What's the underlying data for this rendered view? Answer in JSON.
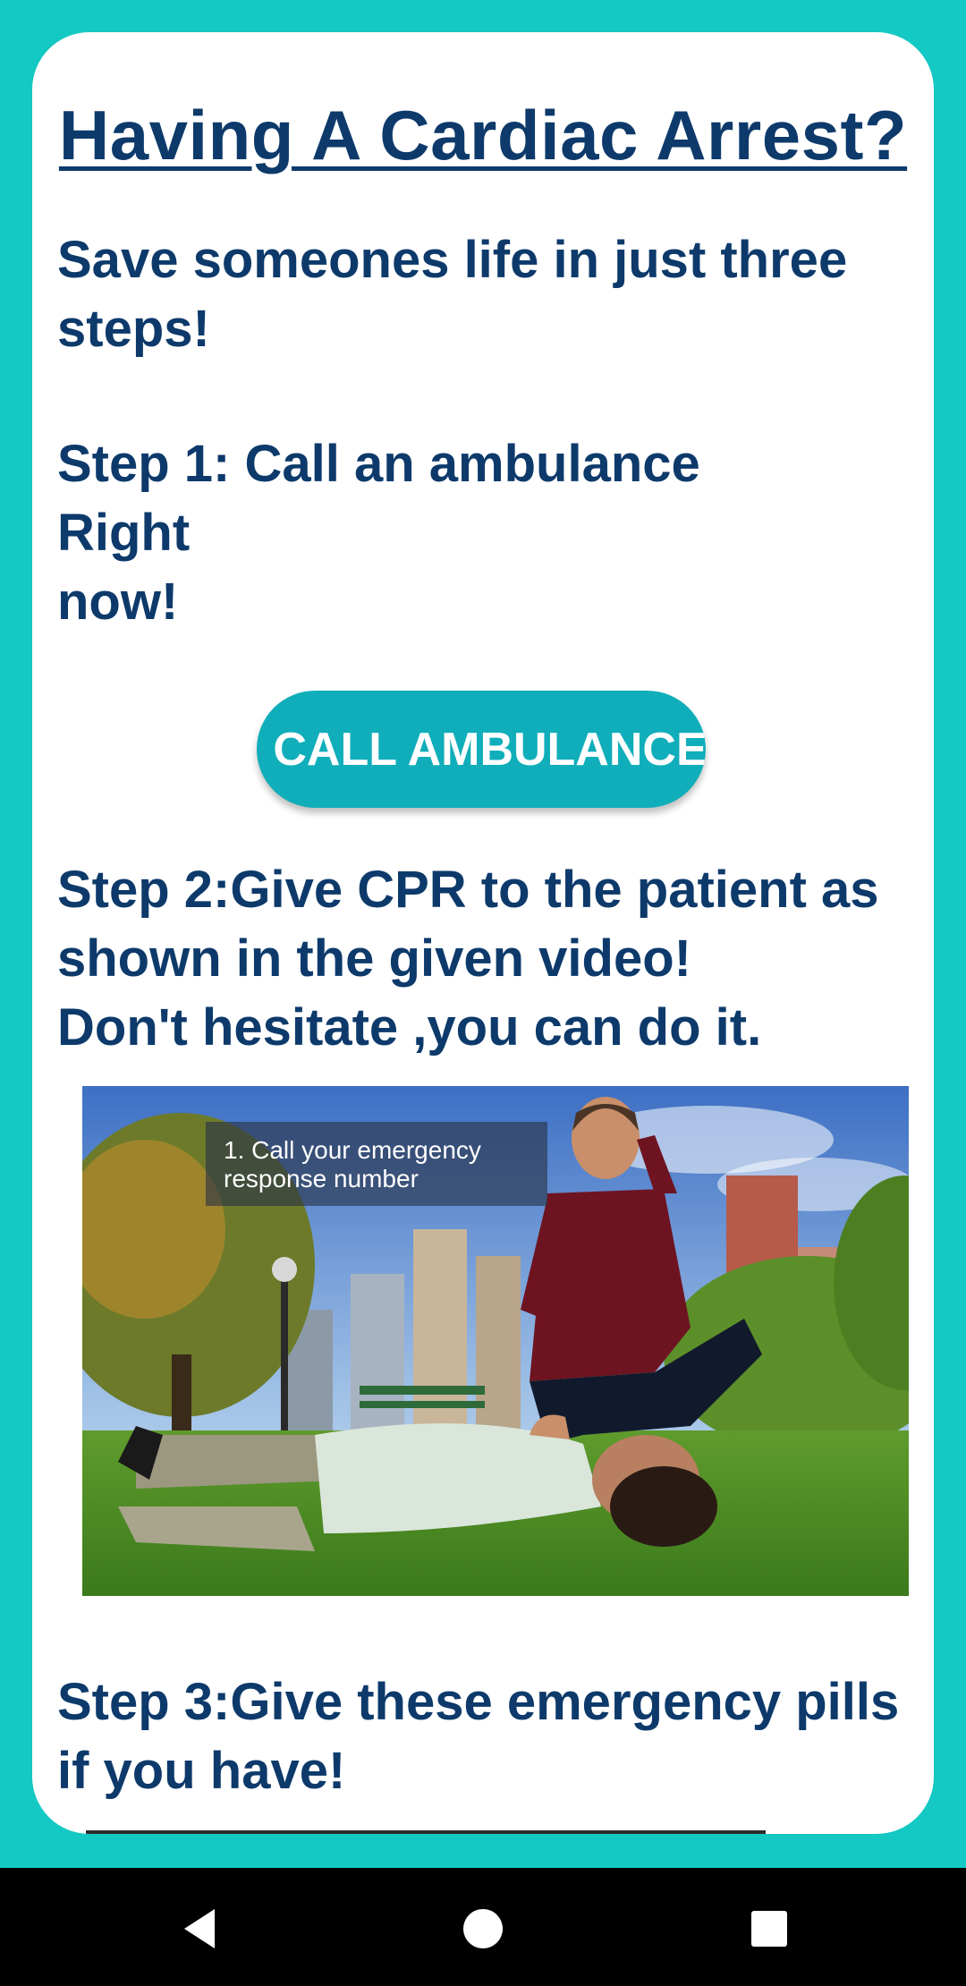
{
  "colors": {
    "background": "#14c8c3",
    "card": "#ffffff",
    "text": "#0d3a6b",
    "button": "#10aeba",
    "nav_bar": "#000000"
  },
  "page": {
    "title": "Having A Cardiac Arrest?",
    "intro": "Save someones life in just three steps!",
    "step1": " Step 1: Call an ambulance\nRight\n now!",
    "call_button_label": "CALL AMBULANCE",
    "step2": "Step 2:Give CPR to the patient as shown in the given video!\nDon't hesitate ,you can do it.",
    "video_caption": "1. Call your emergency\nresponse number",
    "step3": "Step 3:Give these emergency pills if you have!"
  },
  "nav": {
    "back_icon": "back-triangle",
    "home_icon": "home-circle",
    "recents_icon": "recents-square"
  }
}
